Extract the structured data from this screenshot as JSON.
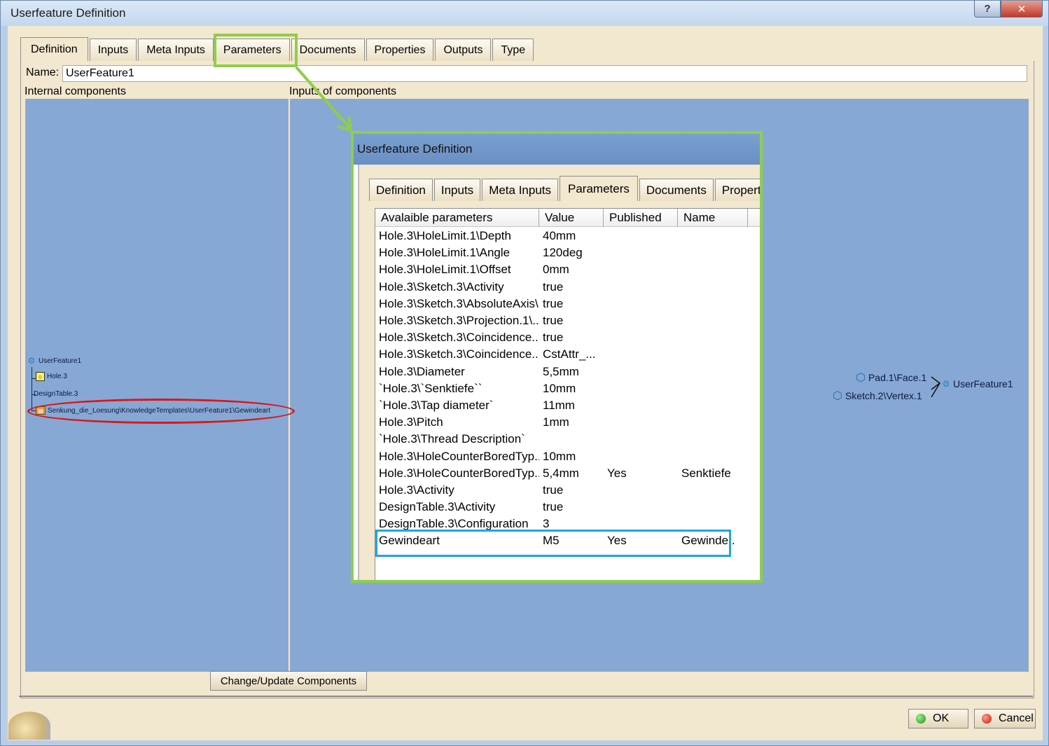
{
  "window": {
    "title": "Userfeature Definition",
    "help_label": "?",
    "close_label": "✕"
  },
  "tabs": [
    "Definition",
    "Inputs",
    "Meta Inputs",
    "Parameters",
    "Documents",
    "Properties",
    "Outputs",
    "Type"
  ],
  "active_tab": "Definition",
  "name": {
    "label": "Name:",
    "value": "UserFeature1"
  },
  "labels": {
    "internal_components": "Internal components",
    "inputs_of_components": "Inputs of components"
  },
  "tree": {
    "root": "UserFeature1",
    "hole": "Hole.3",
    "design_table": "DesignTable.3",
    "parameter_path": "Senkung_die_Loesung\\KnowledgeTemplates\\UserFeature1\\Gewindeart"
  },
  "graph": {
    "input1": "Pad.1\\Face.1",
    "input2": "Sketch.2\\Vertex.1",
    "output": "UserFeature1"
  },
  "buttons": {
    "change_update": "Change/Update Components",
    "ok": "OK",
    "cancel": "Cancel"
  },
  "zoom": {
    "title": "Userfeature Definition",
    "tabs": [
      "Definition",
      "Inputs",
      "Meta Inputs",
      "Parameters",
      "Documents",
      "Propert"
    ],
    "active_tab": "Parameters",
    "columns": [
      "Avalaible parameters",
      "Value",
      "Published",
      "Name"
    ],
    "rows": [
      {
        "param": "Hole.3\\HoleLimit.1\\Depth",
        "value": "40mm",
        "published": "",
        "name": ""
      },
      {
        "param": "Hole.3\\HoleLimit.1\\Angle",
        "value": "120deg",
        "published": "",
        "name": ""
      },
      {
        "param": "Hole.3\\HoleLimit.1\\Offset",
        "value": "0mm",
        "published": "",
        "name": ""
      },
      {
        "param": "Hole.3\\Sketch.3\\Activity",
        "value": "true",
        "published": "",
        "name": ""
      },
      {
        "param": "Hole.3\\Sketch.3\\AbsoluteAxis\\...",
        "value": "true",
        "published": "",
        "name": ""
      },
      {
        "param": "Hole.3\\Sketch.3\\Projection.1\\...",
        "value": "true",
        "published": "",
        "name": ""
      },
      {
        "param": "Hole.3\\Sketch.3\\Coincidence....",
        "value": "true",
        "published": "",
        "name": ""
      },
      {
        "param": "Hole.3\\Sketch.3\\Coincidence....",
        "value": "CstAttr_...",
        "published": "",
        "name": ""
      },
      {
        "param": "Hole.3\\Diameter",
        "value": "5,5mm",
        "published": "",
        "name": ""
      },
      {
        "param": "`Hole.3\\`Senktiefe``",
        "value": "10mm",
        "published": "",
        "name": ""
      },
      {
        "param": "`Hole.3\\Tap diameter`",
        "value": "11mm",
        "published": "",
        "name": ""
      },
      {
        "param": "Hole.3\\Pitch",
        "value": "1mm",
        "published": "",
        "name": ""
      },
      {
        "param": "`Hole.3\\Thread Description`",
        "value": "",
        "published": "",
        "name": ""
      },
      {
        "param": "Hole.3\\HoleCounterBoredTyp...",
        "value": "10mm",
        "published": "",
        "name": ""
      },
      {
        "param": "Hole.3\\HoleCounterBoredTyp...",
        "value": "5,4mm",
        "published": "Yes",
        "name": "Senktiefe"
      },
      {
        "param": "Hole.3\\Activity",
        "value": "true",
        "published": "",
        "name": ""
      },
      {
        "param": "DesignTable.3\\Activity",
        "value": "true",
        "published": "",
        "name": ""
      },
      {
        "param": "DesignTable.3\\Configuration",
        "value": "3",
        "published": "",
        "name": ""
      },
      {
        "param": "Gewindeart",
        "value": "M5",
        "published": "Yes",
        "name": "Gewinde.."
      }
    ]
  },
  "colors": {
    "highlight_green": "#8fce4a",
    "highlight_red": "#d9171a",
    "highlight_blue": "#1ea5e6",
    "pane_blue": "#87a8d4"
  }
}
